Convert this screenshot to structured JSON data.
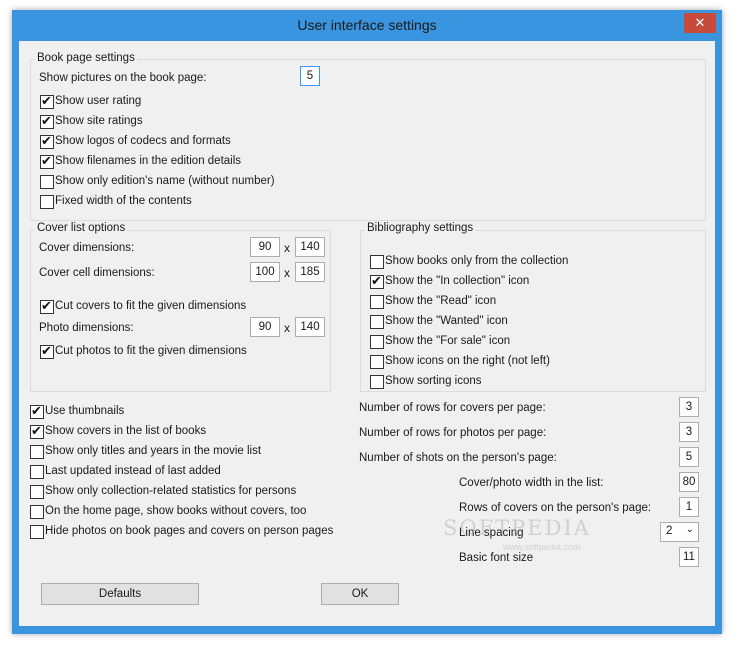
{
  "window": {
    "title": "User interface settings",
    "close_label": "✕"
  },
  "book_page": {
    "title": "Book page settings",
    "pictures_label": "Show pictures on the book page:",
    "pictures_value": "5",
    "checks": [
      {
        "label": "Show user rating",
        "checked": true
      },
      {
        "label": "Show site ratings",
        "checked": true
      },
      {
        "label": "Show logos of codecs and formats",
        "checked": true
      },
      {
        "label": "Show filenames in the edition details",
        "checked": true
      },
      {
        "label": "Show only edition's name (without number)",
        "checked": false
      },
      {
        "label": "Fixed width of the contents",
        "checked": false
      }
    ]
  },
  "cover_list": {
    "title": "Cover list options",
    "cover_dim_label": "Cover dimensions:",
    "cover_dim_w": "90",
    "cover_dim_h": "140",
    "cell_dim_label": "Cover cell dimensions:",
    "cell_dim_w": "100",
    "cell_dim_h": "185",
    "cut_covers": {
      "label": "Cut covers to fit the given dimensions",
      "checked": true
    },
    "photo_dim_label": "Photo dimensions:",
    "photo_dim_w": "90",
    "photo_dim_h": "140",
    "cut_photos": {
      "label": "Cut photos to fit the given dimensions",
      "checked": true
    },
    "x": "x"
  },
  "bibliography": {
    "title": "Bibliography settings",
    "checks": [
      {
        "label": "Show books only from the collection",
        "checked": false
      },
      {
        "label": "Show the \"In collection\" icon",
        "checked": true
      },
      {
        "label": "Show the \"Read\" icon",
        "checked": false
      },
      {
        "label": "Show the \"Wanted\" icon",
        "checked": false
      },
      {
        "label": "Show the \"For sale\" icon",
        "checked": false
      },
      {
        "label": "Show icons on the right (not left)",
        "checked": false
      },
      {
        "label": "Show sorting icons",
        "checked": false
      }
    ]
  },
  "general": {
    "checks": [
      {
        "label": "Use thumbnails",
        "checked": true
      },
      {
        "label": "Show covers in the list of books",
        "checked": true
      },
      {
        "label": "Show only titles and years in the movie list",
        "checked": false
      },
      {
        "label": "Last updated instead of last added",
        "checked": false
      },
      {
        "label": "Show only collection-related statistics for persons",
        "checked": false
      },
      {
        "label": "On the home page, show books without covers, too",
        "checked": false
      },
      {
        "label": "Hide photos on book pages and covers on person pages",
        "checked": false
      }
    ]
  },
  "numbers": {
    "rows_covers_label": "Number of rows for covers per page:",
    "rows_covers": "3",
    "rows_photos_label": "Number of rows for photos per page:",
    "rows_photos": "3",
    "shots_label": "Number of shots on the person's page:",
    "shots": "5",
    "cover_width_label": "Cover/photo width in the list:",
    "cover_width": "80",
    "rows_person_label": "Rows of covers on the person's page:",
    "rows_person": "1",
    "line_spacing_label": "Line spacing",
    "line_spacing": "2",
    "font_size_label": "Basic font size",
    "font_size": "11"
  },
  "buttons": {
    "defaults": "Defaults",
    "ok": "OK"
  },
  "watermark": {
    "main": "SOFTPEDIA",
    "sub": "www.softpedia.com"
  }
}
